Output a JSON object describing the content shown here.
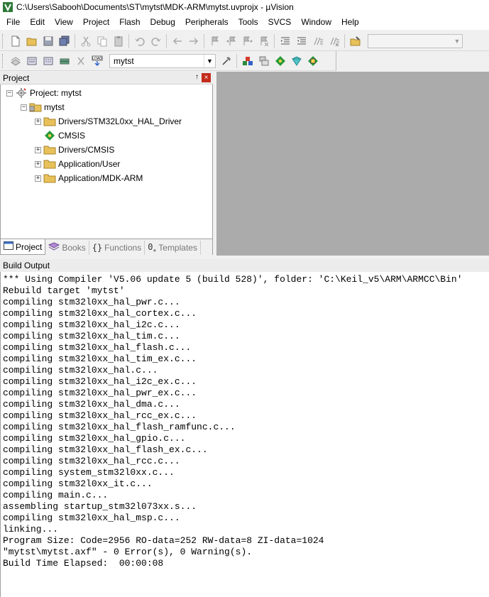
{
  "window": {
    "title": "C:\\Users\\Sabooh\\Documents\\ST\\mytst\\MDK-ARM\\mytst.uvprojx - µVision"
  },
  "menu": [
    "File",
    "Edit",
    "View",
    "Project",
    "Flash",
    "Debug",
    "Peripherals",
    "Tools",
    "SVCS",
    "Window",
    "Help"
  ],
  "toolbar2": {
    "target_value": "mytst"
  },
  "project_panel": {
    "title": "Project",
    "pin_glyph": "↑",
    "close_glyph": "×",
    "tree": {
      "root": "Project: mytst",
      "target": "mytst",
      "groups": [
        "Drivers/STM32L0xx_HAL_Driver",
        "CMSIS",
        "Drivers/CMSIS",
        "Application/User",
        "Application/MDK-ARM"
      ]
    },
    "tabs": [
      {
        "label": "Project",
        "icon": "project-icon",
        "active": true
      },
      {
        "label": "Books",
        "icon": "books-icon",
        "active": false
      },
      {
        "label": "Functions",
        "icon": "functions-icon",
        "active": false
      },
      {
        "label": "Templates",
        "icon": "templates-icon",
        "active": false
      }
    ]
  },
  "build_output": {
    "title": "Build Output",
    "lines": [
      "*** Using Compiler 'V5.06 update 5 (build 528)', folder: 'C:\\Keil_v5\\ARM\\ARMCC\\Bin'",
      "Rebuild target 'mytst'",
      "compiling stm32l0xx_hal_pwr.c...",
      "compiling stm32l0xx_hal_cortex.c...",
      "compiling stm32l0xx_hal_i2c.c...",
      "compiling stm32l0xx_hal_tim.c...",
      "compiling stm32l0xx_hal_flash.c...",
      "compiling stm32l0xx_hal_tim_ex.c...",
      "compiling stm32l0xx_hal.c...",
      "compiling stm32l0xx_hal_i2c_ex.c...",
      "compiling stm32l0xx_hal_pwr_ex.c...",
      "compiling stm32l0xx_hal_dma.c...",
      "compiling stm32l0xx_hal_rcc_ex.c...",
      "compiling stm32l0xx_hal_flash_ramfunc.c...",
      "compiling stm32l0xx_hal_gpio.c...",
      "compiling stm32l0xx_hal_flash_ex.c...",
      "compiling stm32l0xx_hal_rcc.c...",
      "compiling system_stm32l0xx.c...",
      "compiling stm32l0xx_it.c...",
      "compiling main.c...",
      "assembling startup_stm32l073xx.s...",
      "compiling stm32l0xx_hal_msp.c...",
      "linking...",
      "Program Size: Code=2956 RO-data=252 RW-data=8 ZI-data=1024",
      "\"mytst\\mytst.axf\" - 0 Error(s), 0 Warning(s).",
      "Build Time Elapsed:  00:00:08"
    ]
  },
  "colors": {
    "editor_bg": "#ababab",
    "folder": "#e8c15a",
    "close": "#c42b1c"
  }
}
